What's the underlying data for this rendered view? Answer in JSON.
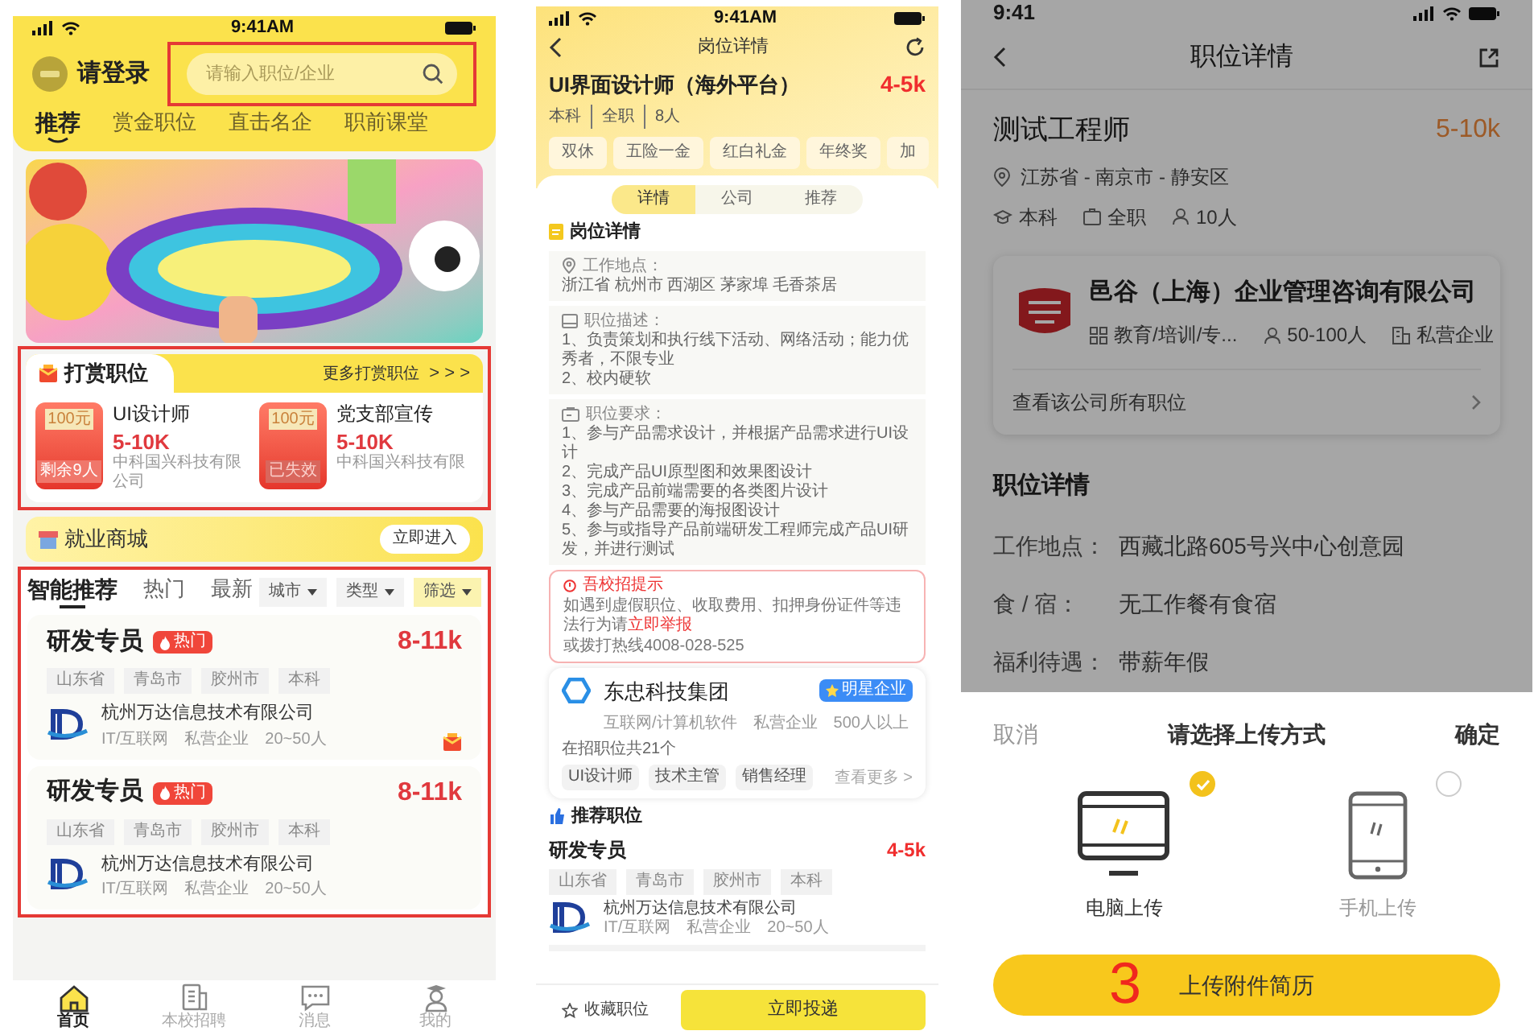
{
  "home": {
    "status_time": "9:41AM",
    "login_label": "请登录",
    "search": {
      "placeholder": "请输入职位/企业"
    },
    "tabs": [
      {
        "label": "推荐",
        "selected": true
      },
      {
        "label": "赏金职位",
        "selected": false
      },
      {
        "label": "直击名企",
        "selected": false
      },
      {
        "label": "职前课堂",
        "selected": false
      }
    ],
    "reward_section": {
      "title": "打赏职位",
      "more": "更多打赏职位",
      "more_arrows": "> > >",
      "cards": [
        {
          "amount": "100元",
          "status": "剩余9人",
          "expired": false,
          "job": "UI设计师",
          "salary": "5-10K",
          "company": "中科国兴科技有限公司"
        },
        {
          "amount": "100元",
          "status": "已失效",
          "expired": true,
          "job": "党支部宣传",
          "salary": "5-10K",
          "company": "中科国兴科技有限"
        }
      ]
    },
    "mall": {
      "title": "就业商城",
      "button": "立即进入"
    },
    "feed_tabs": [
      {
        "label": "智能推荐",
        "selected": true
      },
      {
        "label": "热门",
        "selected": false
      },
      {
        "label": "最新",
        "selected": false
      }
    ],
    "filters": [
      {
        "label": "城市",
        "highlighted": false
      },
      {
        "label": "类型",
        "highlighted": false
      },
      {
        "label": "筛选",
        "highlighted": true
      }
    ],
    "jobs": [
      {
        "title": "研发专员",
        "badge": "热门",
        "salary": "8-11k",
        "tags": [
          "山东省",
          "青岛市",
          "胶州市",
          "本科"
        ],
        "company": "杭州万达信息技术有限公司",
        "meta": [
          "IT/互联网",
          "私营企业",
          "20~50人"
        ],
        "reward": true
      },
      {
        "title": "研发专员",
        "badge": "热门",
        "salary": "8-11k",
        "tags": [
          "山东省",
          "青岛市",
          "胶州市",
          "本科"
        ],
        "company": "杭州万达信息技术有限公司",
        "meta": [
          "IT/互联网",
          "私营企业",
          "20~50人"
        ],
        "reward": false
      }
    ],
    "nav": [
      {
        "kind": "home",
        "label": "首页",
        "selected": true
      },
      {
        "kind": "document",
        "label": "本校招聘",
        "selected": false
      },
      {
        "kind": "chat",
        "label": "消息",
        "selected": false
      },
      {
        "kind": "person",
        "label": "我的",
        "selected": false
      }
    ]
  },
  "detail": {
    "status_time": "9:41AM",
    "title": "岗位详情",
    "job_title": "UI界面设计师（海外平台）",
    "salary": "4-5k",
    "meta": [
      "本科",
      "全职",
      "8人"
    ],
    "perks": [
      "双休",
      "五险一金",
      "红白礼金",
      "年终奖",
      "加"
    ],
    "tabs": [
      {
        "label": "详情",
        "selected": true
      },
      {
        "label": "公司",
        "selected": false
      },
      {
        "label": "推荐",
        "selected": false
      }
    ],
    "section_title": "岗位详情",
    "blocks": [
      {
        "kind": "location",
        "heading": "工作地点：",
        "lines": [
          "浙江省 杭州市 西湖区 茅家埠 毛香茶居"
        ]
      },
      {
        "kind": "description",
        "heading": "职位描述：",
        "lines": [
          "1、负责策划和执行线下活动、网络活动；能力优秀者，不限专业",
          "2、校内硬软"
        ]
      },
      {
        "kind": "requirements",
        "heading": "职位要求：",
        "lines": [
          "1、参与产品需求设计，并根据产品需求进行UI设计",
          "2、完成产品UI原型图和效果图设计",
          "3、完成产品前端需要的各类图片设计",
          "4、参与产品需要的海报图设计",
          "5、参与或指导产品前端研发工程师完成产品UI研发，并进行测试"
        ]
      }
    ],
    "notice": {
      "title": "吾校招提示",
      "text": "如遇到虚假职位、收取费用、扣押身份证件等违法行为请",
      "link": "立即举报",
      "hotline": "或拨打热线4008-028-525"
    },
    "company": {
      "name": "东忠科技集团",
      "badge": "明星企业",
      "meta": [
        "互联网/计算机软件",
        "私营企业",
        "500人以上"
      ],
      "openings": "在招职位共21个",
      "positions": [
        "UI设计师",
        "技术主管",
        "销售经理"
      ],
      "more": "查看更多 >"
    },
    "recommend": {
      "title": "推荐职位",
      "job": {
        "title": "研发专员",
        "salary": "4-5k",
        "tags": [
          "山东省",
          "青岛市",
          "胶州市",
          "本科"
        ],
        "company": "杭州万达信息技术有限公司",
        "meta": [
          "IT/互联网",
          "私营企业",
          "20~50人"
        ]
      }
    },
    "favorite": "收藏职位",
    "apply": "立即投递"
  },
  "upload": {
    "status_time": "9:41",
    "dimmed": true,
    "title": "职位详情",
    "job_title": "测试工程师",
    "salary": "5-10k",
    "location": "江苏省 - 南京市 - 静安区",
    "facts": [
      {
        "kind": "education",
        "text": "本科"
      },
      {
        "kind": "type",
        "text": "全职"
      },
      {
        "kind": "headcount",
        "text": "10人"
      }
    ],
    "company": {
      "name": "邑谷（上海）企业管理咨询有限公司",
      "facts": [
        {
          "kind": "industry",
          "text": "教育/培训/专..."
        },
        {
          "kind": "headcount",
          "text": "50-100人"
        },
        {
          "kind": "ownership",
          "text": "私营企业"
        }
      ],
      "link": "查看该公司所有职位"
    },
    "section_title": "职位详情",
    "details": [
      {
        "label": "工作地点：",
        "value": "西藏北路605号兴中心创意园"
      },
      {
        "label": "食 / 宿：",
        "value": "无工作餐有食宿"
      },
      {
        "label": "福利待遇：",
        "value": "带薪年假"
      }
    ],
    "sheet": {
      "cancel": "取消",
      "title": "请选择上传方式",
      "confirm": "确定",
      "options": [
        {
          "kind": "computer",
          "label": "电脑上传",
          "selected": true
        },
        {
          "kind": "phone",
          "label": "手机上传",
          "selected": false
        }
      ],
      "button": "上传附件简历",
      "annotation": "3"
    }
  }
}
